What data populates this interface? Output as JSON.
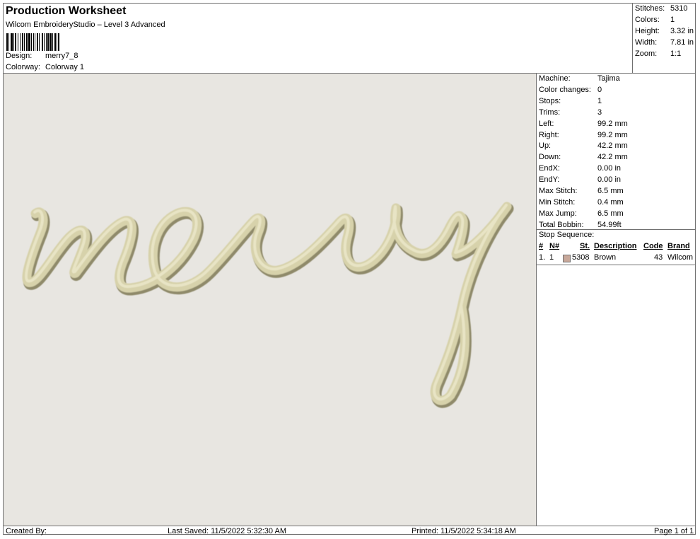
{
  "header": {
    "title": "Production Worksheet",
    "subtitle": "Wilcom EmbroideryStudio – Level 3 Advanced",
    "design_label": "Design:",
    "design_value": "merry7_8",
    "colorway_label": "Colorway:",
    "colorway_value": "Colorway 1"
  },
  "stats": {
    "stitches_label": "Stitches:",
    "stitches_value": "5310",
    "colors_label": "Colors:",
    "colors_value": "1",
    "height_label": "Height:",
    "height_value": "3.32 in",
    "width_label": "Width:",
    "width_value": "7.81 in",
    "zoom_label": "Zoom:",
    "zoom_value": "1:1"
  },
  "machine": {
    "rows": [
      {
        "label": "Machine:",
        "value": "Tajima"
      },
      {
        "label": "Color changes:",
        "value": "0"
      },
      {
        "label": "Stops:",
        "value": "1"
      },
      {
        "label": "Trims:",
        "value": "3"
      },
      {
        "label": "Left:",
        "value": "99.2 mm"
      },
      {
        "label": "Right:",
        "value": "99.2 mm"
      },
      {
        "label": "Up:",
        "value": "42.2 mm"
      },
      {
        "label": "Down:",
        "value": "42.2 mm"
      },
      {
        "label": "EndX:",
        "value": "0.00 in"
      },
      {
        "label": "EndY:",
        "value": "0.00 in"
      },
      {
        "label": "Max Stitch:",
        "value": "6.5 mm"
      },
      {
        "label": "Min Stitch:",
        "value": "0.4 mm"
      },
      {
        "label": "Max Jump:",
        "value": "6.5 mm"
      },
      {
        "label": "Total Bobbin:",
        "value": "54.99ft"
      }
    ]
  },
  "stop_sequence": {
    "title": "Stop Sequence:",
    "columns": {
      "num": "#",
      "n": "N#",
      "st": "St.",
      "description": "Description",
      "code": "Code",
      "brand": "Brand"
    },
    "rows": [
      {
        "num": "1.",
        "n": "1",
        "color": "#c8a89a",
        "st": "5308",
        "description": "Brown",
        "code": "43",
        "brand": "Wilcom"
      }
    ]
  },
  "footer": {
    "created_by": "Created By:",
    "last_saved": "Last Saved: 11/5/2022 5:32:30 AM",
    "printed": "Printed: 11/5/2022 5:34:18 AM",
    "page": "Page 1 of 1"
  },
  "colors": {
    "canvas": "#e8e6e1",
    "thread": "#d9d4ae",
    "thread_shadow": "#8f8a6a"
  }
}
